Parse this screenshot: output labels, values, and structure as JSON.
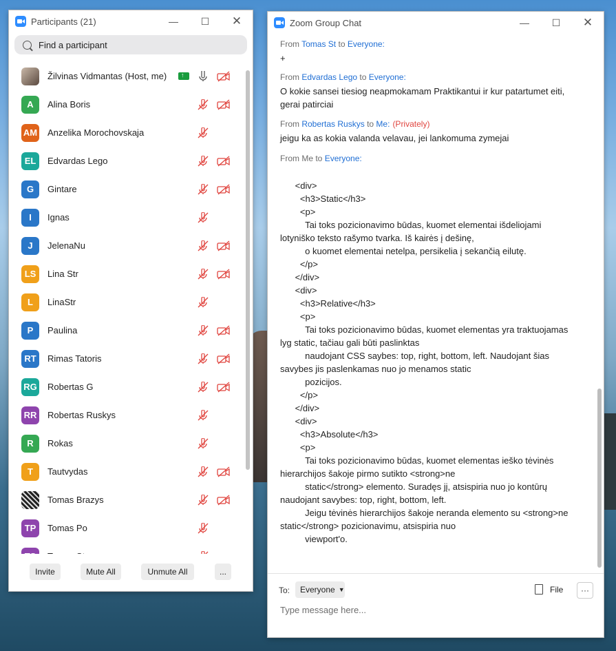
{
  "participants": {
    "title": "Participants (21)",
    "search_placeholder": "Find a participant",
    "rows": [
      {
        "name": "Žilvinas Vidmantas (Host, me)",
        "initials": "",
        "color": "",
        "photo": "photo",
        "share": true,
        "mic": "on",
        "video": "off"
      },
      {
        "name": "Alina Boris",
        "initials": "A",
        "color": "#35a853",
        "mic": "off",
        "video": "off"
      },
      {
        "name": "Anzelika Morochovskaja",
        "initials": "AM",
        "color": "#e0631a",
        "mic": "off",
        "video": "none"
      },
      {
        "name": "Edvardas Lego",
        "initials": "EL",
        "color": "#1ba89a",
        "mic": "off",
        "video": "off"
      },
      {
        "name": "Gintare",
        "initials": "G",
        "color": "#2a77c8",
        "mic": "off",
        "video": "off"
      },
      {
        "name": "Ignas",
        "initials": "I",
        "color": "#2a77c8",
        "mic": "off",
        "video": "none"
      },
      {
        "name": "JelenaNu",
        "initials": "J",
        "color": "#2a77c8",
        "mic": "off",
        "video": "off"
      },
      {
        "name": "Lina Str",
        "initials": "LS",
        "color": "#f0a01a",
        "mic": "off",
        "video": "off"
      },
      {
        "name": "LinaStr",
        "initials": "L",
        "color": "#f0a01a",
        "mic": "off",
        "video": "none"
      },
      {
        "name": "Paulina",
        "initials": "P",
        "color": "#2a77c8",
        "mic": "off",
        "video": "off"
      },
      {
        "name": "Rimas Tatoris",
        "initials": "RT",
        "color": "#2a77c8",
        "mic": "off",
        "video": "off"
      },
      {
        "name": "Robertas G",
        "initials": "RG",
        "color": "#1ba89a",
        "mic": "off",
        "video": "off"
      },
      {
        "name": "Robertas Ruskys",
        "initials": "RR",
        "color": "#8e44ad",
        "mic": "off",
        "video": "none"
      },
      {
        "name": "Rokas",
        "initials": "R",
        "color": "#35a853",
        "mic": "off",
        "video": "none"
      },
      {
        "name": "Tautvydas",
        "initials": "T",
        "color": "#f0a01a",
        "mic": "off",
        "video": "off"
      },
      {
        "name": "Tomas Brazys",
        "initials": "",
        "color": "",
        "photo": "photo2",
        "mic": "off",
        "video": "off"
      },
      {
        "name": "Tomas Po",
        "initials": "TP",
        "color": "#8e44ad",
        "mic": "off",
        "video": "none"
      },
      {
        "name": "Tomas St",
        "initials": "TS",
        "color": "#8e44ad",
        "mic": "off",
        "video": "none"
      }
    ],
    "buttons": {
      "invite": "Invite",
      "mute_all": "Mute All",
      "unmute_all": "Unmute All",
      "more": "..."
    }
  },
  "chat": {
    "title": "Zoom Group Chat",
    "messages": [
      {
        "from": "From",
        "sender": "Tomas St",
        "to": "to",
        "recipient": "Everyone:",
        "private": "",
        "text": "+"
      },
      {
        "from": "From",
        "sender": "Edvardas Lego",
        "to": "to",
        "recipient": "Everyone:",
        "private": "",
        "text": "O kokie sansei tiesiog neapmokamam Praktikantui ir kur patartumet eiti, gerai patirciai"
      },
      {
        "from": "From",
        "sender": "Robertas Ruskys",
        "to": "to",
        "recipient": "Me:",
        "private": "(Privately)",
        "text": "jeigu ka as kokia valanda velavau, jei lankomuma zymejai"
      },
      {
        "from": "From Me",
        "sender": "",
        "to": "to",
        "recipient": "Everyone:",
        "private": "",
        "text": "\n      <div>\n        <h3>Static</h3>\n        <p>\n          Tai toks pozicionavimo būdas, kuomet elementai išdeliojami lotyniško teksto rašymo tvarka. Iš kairės į dešinę,\n          o kuomet elementai netelpa, persikelia į sekančią eilutę.\n        </p>\n      </div>\n      <div>\n        <h3>Relative</h3>\n        <p>\n          Tai toks pozicionavimo būdas, kuomet elementas yra traktuojamas lyg static, tačiau gali būti paslinktas\n          naudojant CSS saybes: top, right, bottom, left. Naudojant šias savybes jis paslenkamas nuo jo menamos static\n          pozicijos.\n        </p>\n      </div>\n      <div>\n        <h3>Absolute</h3>\n        <p>\n          Tai toks pozicionavimo būdas, kuomet elementas ieško tėvinės hierarchijos šakoje pirmo sutikto <strong>ne\n          static</strong> elemento. Suradęs jį, atsispiria nuo jo kontūrų naudojant savybes: top, right, bottom, left.\n          Jeigu tėvinės hierarchijos šakoje neranda elemento su <strong>ne static</strong> pozicionavimu, atsispiria nuo\n          viewport'o."
      }
    ],
    "to_label": "To:",
    "to_value": "Everyone",
    "file_label": "File",
    "more": "···",
    "input_placeholder": "Type message here..."
  }
}
